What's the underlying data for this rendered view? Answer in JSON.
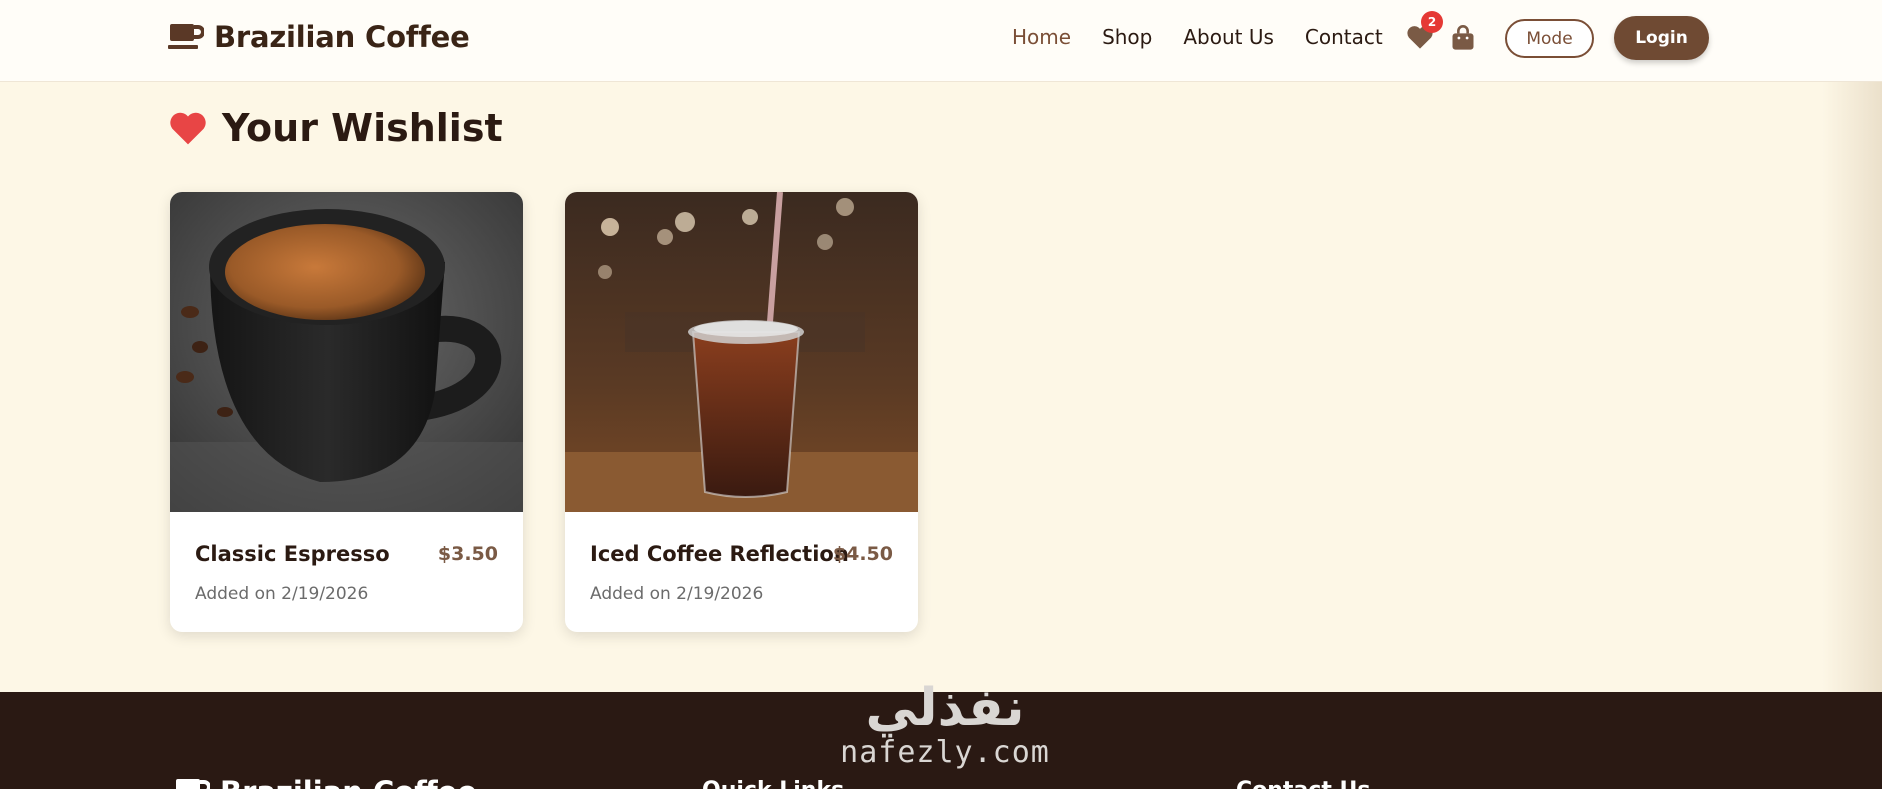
{
  "header": {
    "brand": {
      "name": "Brazilian Coffee",
      "icon": "coffee-cup-icon"
    },
    "nav": [
      {
        "label": "Home",
        "active": true
      },
      {
        "label": "Shop",
        "active": false
      },
      {
        "label": "About Us",
        "active": false
      },
      {
        "label": "Contact",
        "active": false
      }
    ],
    "wishlist_icon": "heart-icon",
    "wishlist_count": "2",
    "cart_icon": "shopping-bag-icon",
    "mode_label": "Mode",
    "login_label": "Login"
  },
  "wishlist": {
    "title": "Your Wishlist",
    "title_icon": "heart-icon",
    "items": [
      {
        "name": "Classic Espresso",
        "price": "$3.50",
        "added": "Added on 2/19/2026",
        "image": "espresso-cup-photo"
      },
      {
        "name": "Iced Coffee Reflection",
        "price": "$4.50",
        "added": "Added on 2/19/2026",
        "image": "iced-coffee-photo"
      }
    ]
  },
  "footer": {
    "brand": "Brazilian Coffee",
    "quick_links_title": "Quick Links",
    "contact_title": "Contact Us"
  },
  "watermark": {
    "arabic": "نفذلي",
    "latin": "nafezly.com"
  },
  "colors": {
    "brand_brown": "#6f4a33",
    "accent_red": "#e53935",
    "page_bg": "#fdf7e6",
    "footer_bg": "#2a1913"
  }
}
